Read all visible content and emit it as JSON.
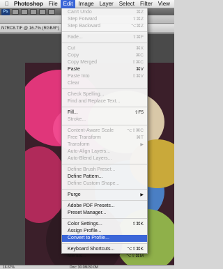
{
  "menubar": {
    "app": "Photoshop",
    "items": [
      "File",
      "Edit",
      "Image",
      "Layer",
      "Select",
      "Filter",
      "View"
    ],
    "active": "Edit"
  },
  "document": {
    "title": "N7RC8.TIF @ 16.7% (RGB/8*)",
    "zoom": "16.67%",
    "doc_size": "Doc: 30.0M/30.0M"
  },
  "ps_logo": "Ps",
  "edit_menu": {
    "groups": [
      [
        {
          "label": "Can't Undo",
          "shortcut": "⌘Z",
          "enabled": false
        },
        {
          "label": "Step Forward",
          "shortcut": "⇧⌘Z",
          "enabled": false
        },
        {
          "label": "Step Backward",
          "shortcut": "⌥⌘Z",
          "enabled": false
        }
      ],
      [
        {
          "label": "Fade...",
          "shortcut": "⇧⌘F",
          "enabled": false
        }
      ],
      [
        {
          "label": "Cut",
          "shortcut": "⌘X",
          "enabled": false
        },
        {
          "label": "Copy",
          "shortcut": "⌘C",
          "enabled": false
        },
        {
          "label": "Copy Merged",
          "shortcut": "⇧⌘C",
          "enabled": false
        },
        {
          "label": "Paste",
          "shortcut": "⌘V",
          "enabled": true
        },
        {
          "label": "Paste Into",
          "shortcut": "⇧⌘V",
          "enabled": false
        },
        {
          "label": "Clear",
          "shortcut": "",
          "enabled": false
        }
      ],
      [
        {
          "label": "Check Spelling...",
          "shortcut": "",
          "enabled": false
        },
        {
          "label": "Find and Replace Text...",
          "shortcut": "",
          "enabled": false
        }
      ],
      [
        {
          "label": "Fill...",
          "shortcut": "⇧F5",
          "enabled": true
        },
        {
          "label": "Stroke...",
          "shortcut": "",
          "enabled": false
        }
      ],
      [
        {
          "label": "Content-Aware Scale",
          "shortcut": "⌥⇧⌘C",
          "enabled": false
        },
        {
          "label": "Free Transform",
          "shortcut": "⌘T",
          "enabled": false
        },
        {
          "label": "Transform",
          "shortcut": "",
          "enabled": false,
          "submenu": true
        },
        {
          "label": "Auto-Align Layers...",
          "shortcut": "",
          "enabled": false
        },
        {
          "label": "Auto-Blend Layers...",
          "shortcut": "",
          "enabled": false
        }
      ],
      [
        {
          "label": "Define Brush Preset...",
          "shortcut": "",
          "enabled": false
        },
        {
          "label": "Define Pattern...",
          "shortcut": "",
          "enabled": true
        },
        {
          "label": "Define Custom Shape...",
          "shortcut": "",
          "enabled": false
        }
      ],
      [
        {
          "label": "Purge",
          "shortcut": "",
          "enabled": true,
          "submenu": true
        }
      ],
      [
        {
          "label": "Adobe PDF Presets...",
          "shortcut": "",
          "enabled": true
        },
        {
          "label": "Preset Manager...",
          "shortcut": "",
          "enabled": true
        }
      ],
      [
        {
          "label": "Color Settings...",
          "shortcut": "⇧⌘K",
          "enabled": true
        },
        {
          "label": "Assign Profile...",
          "shortcut": "",
          "enabled": true
        },
        {
          "label": "Convert to Profile...",
          "shortcut": "",
          "enabled": true,
          "highlighted": true
        }
      ],
      [
        {
          "label": "Keyboard Shortcuts...",
          "shortcut": "⌥⇧⌘K",
          "enabled": true
        },
        {
          "label": "Menus...",
          "shortcut": "⌥⇧⌘M",
          "enabled": true
        }
      ]
    ]
  },
  "colors": {
    "highlight": "#3b66d8",
    "disabled_text": "#a8a8a8"
  }
}
